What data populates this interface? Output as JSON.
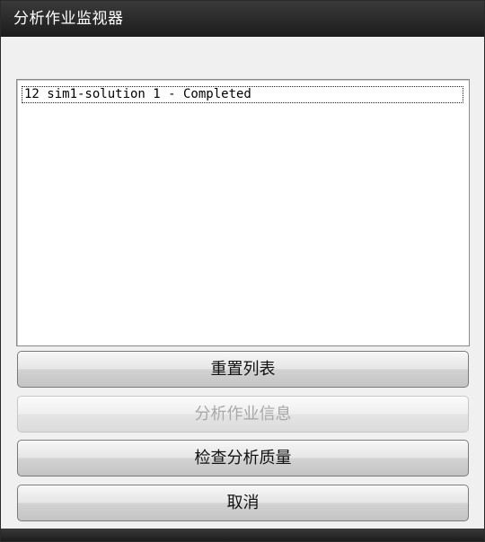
{
  "window": {
    "title": "分析作业监视器"
  },
  "job_list": {
    "items": [
      "12 sim1-solution 1 - Completed"
    ]
  },
  "buttons": {
    "reset_list": "重置列表",
    "job_info": "分析作业信息",
    "check_quality": "检查分析质量",
    "cancel": "取消"
  }
}
